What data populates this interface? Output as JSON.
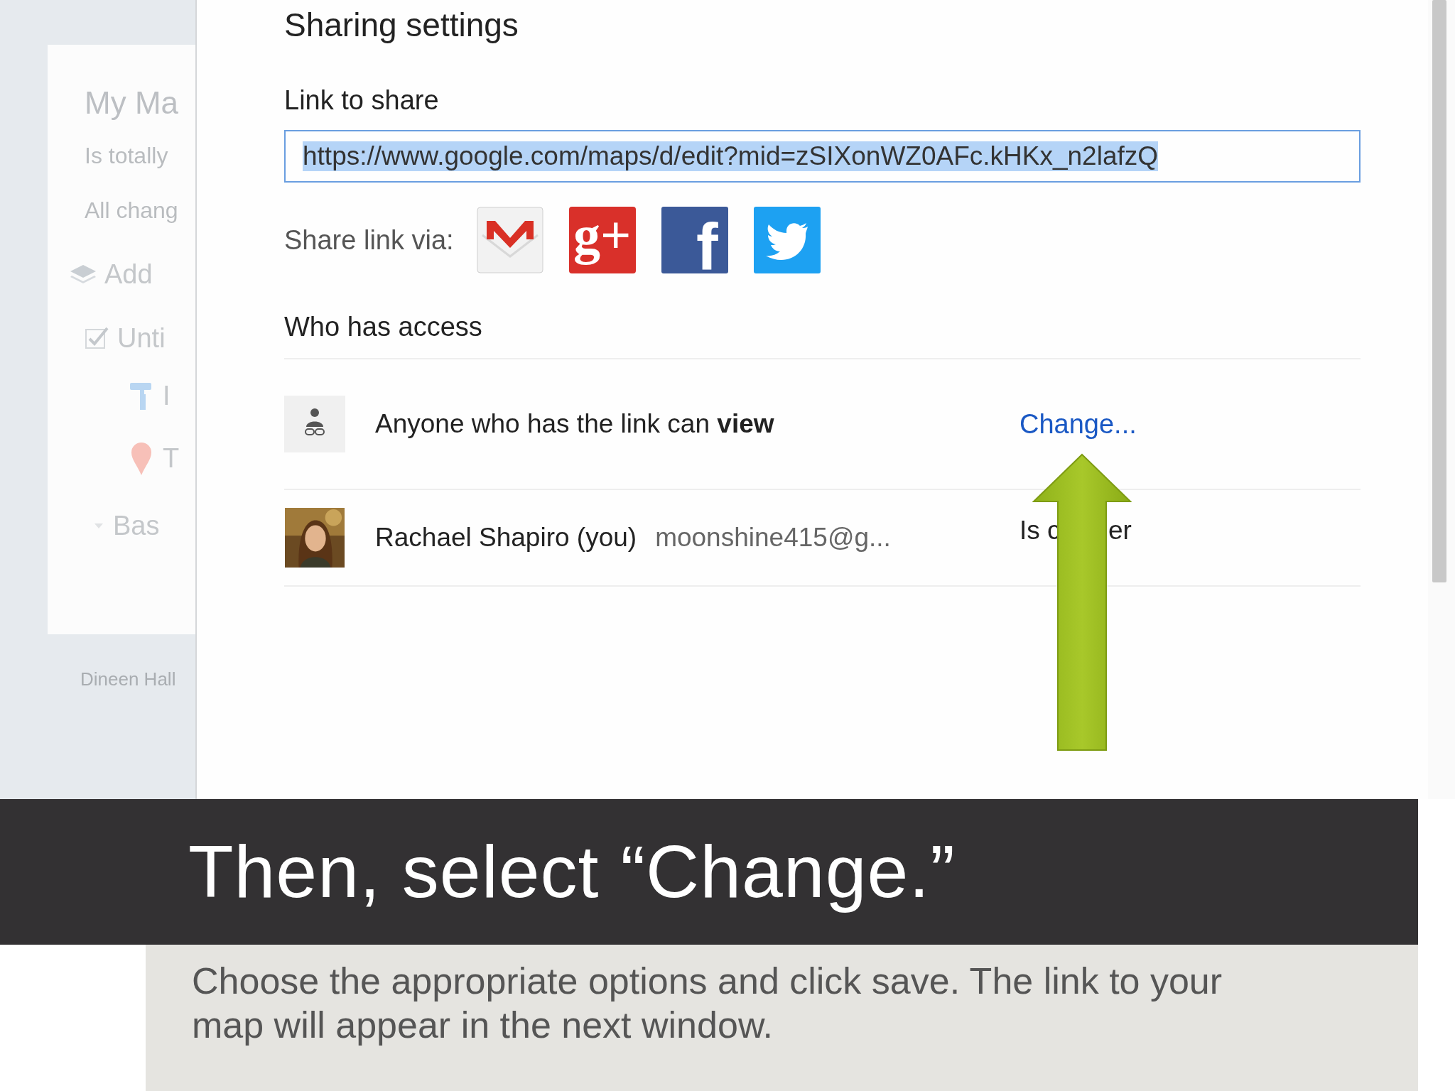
{
  "background_map": {
    "title": "My Ma",
    "subtitle": "Is totally",
    "status": "All chang",
    "add_layer": "Add",
    "layer": {
      "name": "Unti",
      "checked": true
    },
    "layer_items": [
      {
        "kind": "style",
        "label": "I"
      },
      {
        "kind": "pin",
        "label": "T"
      }
    ],
    "base": "Bas",
    "footer": "Dineen Hall"
  },
  "dialog": {
    "title": "Sharing settings",
    "link_label": "Link to share",
    "link_value": "https://www.google.com/maps/d/edit?mid=zSIXonWZ0AFc.kHKx_n2lafzQ",
    "link_text_selected": true,
    "share_label": "Share link via:",
    "share_services": [
      {
        "kind": "gmail"
      },
      {
        "kind": "googleplus",
        "glyph": "g+"
      },
      {
        "kind": "facebook",
        "glyph": "f"
      },
      {
        "kind": "twitter"
      }
    ],
    "access_heading": "Who has access",
    "access_rows": [
      {
        "kind": "link",
        "text": "Anyone who has the link can **view**",
        "action": "Change..."
      },
      {
        "kind": "person",
        "name": "Rachael Shapiro (you)",
        "email": "moonshine415@g...",
        "role_parts": [
          "Is c",
          "er"
        ]
      }
    ]
  },
  "slide": {
    "title": "Then, select “Change.”",
    "body": "Choose the appropriate options and click save. The link to your map will appear in the next window."
  }
}
